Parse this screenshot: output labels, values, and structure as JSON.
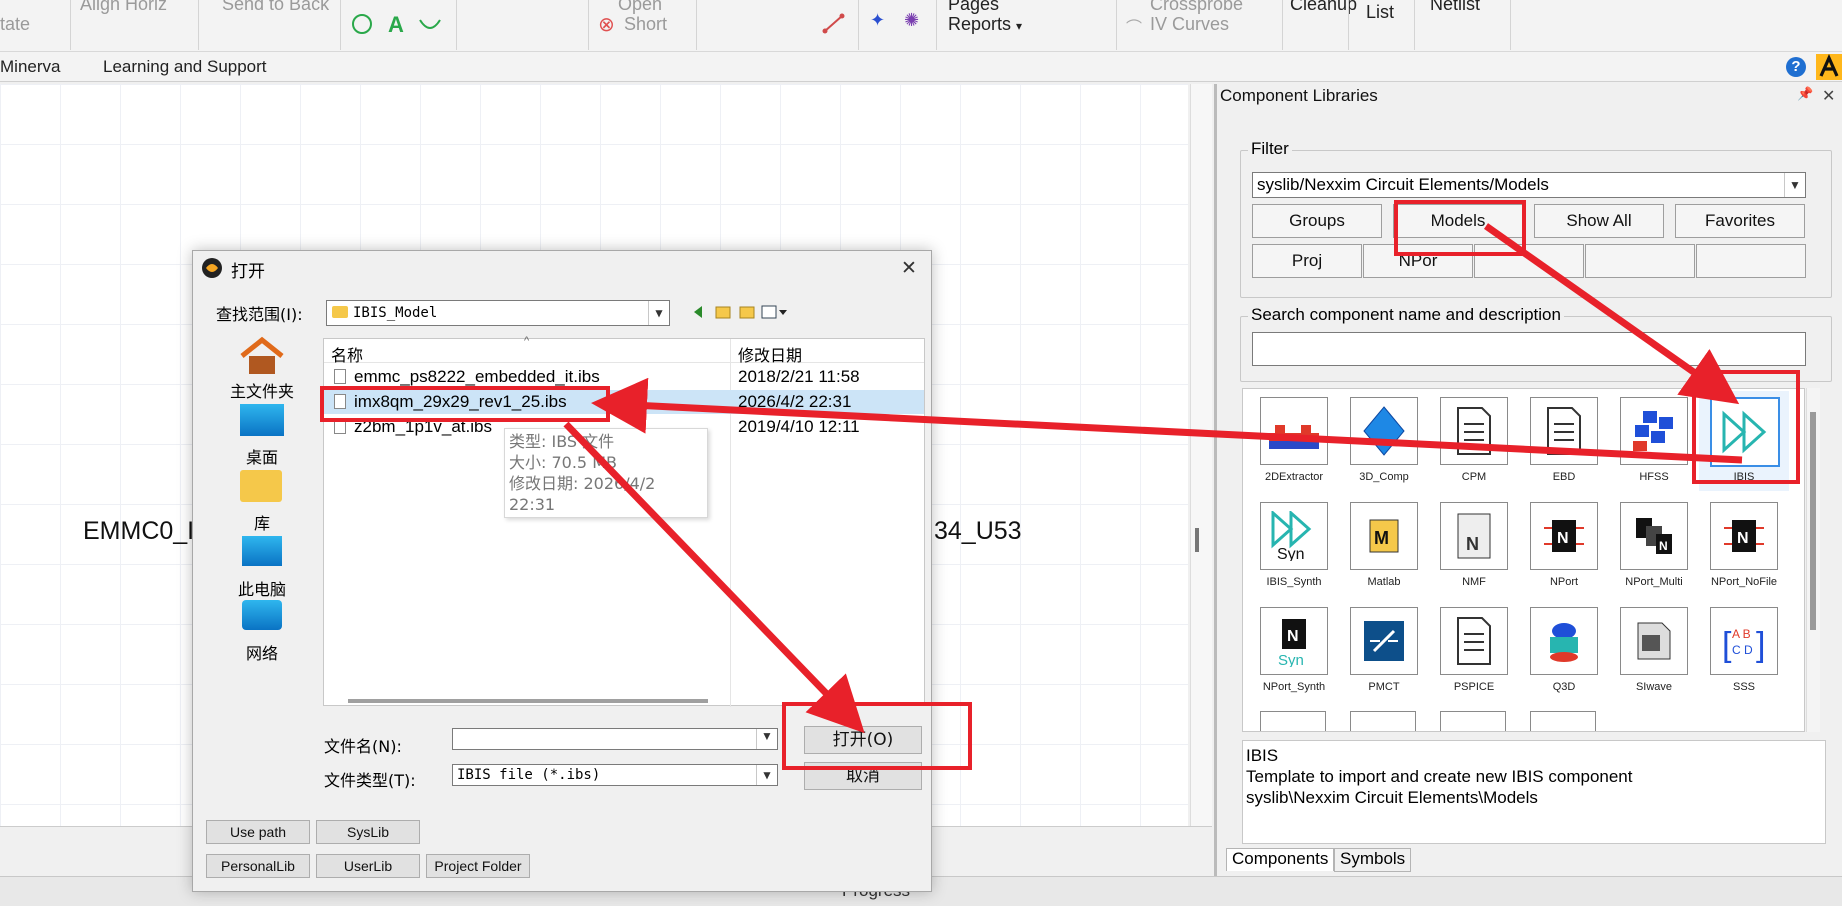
{
  "ribbon": {
    "items": [
      "Align Horiz",
      "Send to Back",
      "Open",
      "Short",
      "Pages",
      "Reports",
      "Crossprobe",
      "IV Curves",
      "Cleanup",
      "List",
      "Netlist",
      "tate"
    ],
    "dropdown_glyph": "▾"
  },
  "menubar": {
    "items": [
      "Minerva",
      "Learning and Support"
    ],
    "help_glyph": "?"
  },
  "canvas": {
    "labels": [
      "EMMC0_I",
      "34_U53"
    ]
  },
  "components": {
    "title": "Component Libraries",
    "pin_glyph": "📌",
    "close_glyph": "✕",
    "filter": {
      "caption": "Filter",
      "path": "syslib/Nexxim Circuit Elements/Models",
      "buttons_row1": [
        "Groups",
        "Models",
        "Show All",
        "Favorites"
      ],
      "buttons_row2": [
        "Proj",
        "NPor",
        "",
        "",
        ""
      ]
    },
    "search": {
      "caption": "Search component name and description",
      "value": ""
    },
    "tiles": [
      {
        "label": "2DExtractor",
        "icon": "extractor-2d-icon"
      },
      {
        "label": "3D_Comp",
        "icon": "diamond-3d-icon"
      },
      {
        "label": "CPM",
        "icon": "document-icon"
      },
      {
        "label": "EBD",
        "icon": "document-icon"
      },
      {
        "label": "HFSS",
        "icon": "hfss-cubes-icon"
      },
      {
        "label": "IBIS",
        "icon": "ibis-icon"
      },
      {
        "label": "IBIS_Synth",
        "icon": "ibis-synth-icon"
      },
      {
        "label": "Matlab",
        "icon": "matlab-icon"
      },
      {
        "label": "NMF",
        "icon": "nmf-icon"
      },
      {
        "label": "NPort",
        "icon": "nport-chip-icon"
      },
      {
        "label": "NPort_Multi",
        "icon": "nport-multi-icon"
      },
      {
        "label": "NPort_NoFile",
        "icon": "nport-chip-icon"
      },
      {
        "label": "NPort_Synth",
        "icon": "nport-synth-icon"
      },
      {
        "label": "PMCT",
        "icon": "pmct-icon"
      },
      {
        "label": "PSPICE",
        "icon": "document-icon"
      },
      {
        "label": "Q3D",
        "icon": "q3d-icon"
      },
      {
        "label": "SIwave",
        "icon": "siwave-icon"
      },
      {
        "label": "SSS",
        "icon": "sss-matrix-icon"
      }
    ],
    "description": {
      "name": "IBIS",
      "text": "Template to import and create new IBIS component",
      "path": "syslib\\Nexxim Circuit Elements\\Models"
    },
    "tabs": [
      "Components",
      "Symbols"
    ]
  },
  "bottom": {
    "progress_label": "Progress"
  },
  "dialog": {
    "title": "打开",
    "look_in_label": "查找范围(I):",
    "look_in_value": "IBIS_Model",
    "nav": [
      "主文件夹",
      "桌面",
      "库",
      "此电脑",
      "网络"
    ],
    "columns": [
      "名称",
      "修改日期"
    ],
    "files": [
      {
        "name": "emmc_ps8222_embedded_it.ibs",
        "date": "2018/2/21 11:58"
      },
      {
        "name": "imx8qm_29x29_rev1_25.ibs",
        "date": "2026/4/2 22:31"
      },
      {
        "name": "z2bm_1p1v_at.ibs",
        "date": "2019/4/10 12:11"
      }
    ],
    "tooltip": [
      "类型: IBS 文件",
      "大小: 70.5 MB",
      "修改日期: 2026/4/2 22:31"
    ],
    "filename_label": "文件名(N):",
    "filename_value": "",
    "filetype_label": "文件类型(T):",
    "filetype_value": "IBIS file (*.ibs)",
    "open_button": "打开(O)",
    "cancel_button": "取消",
    "path_buttons": [
      "Use path",
      "SysLib",
      "PersonalLib",
      "UserLib",
      "Project Folder"
    ],
    "close_glyph": "✕"
  },
  "colors": {
    "annotation_red": "#e8212a",
    "selection_blue": "#cce4f7",
    "ibis_teal": "#27b5b0"
  }
}
